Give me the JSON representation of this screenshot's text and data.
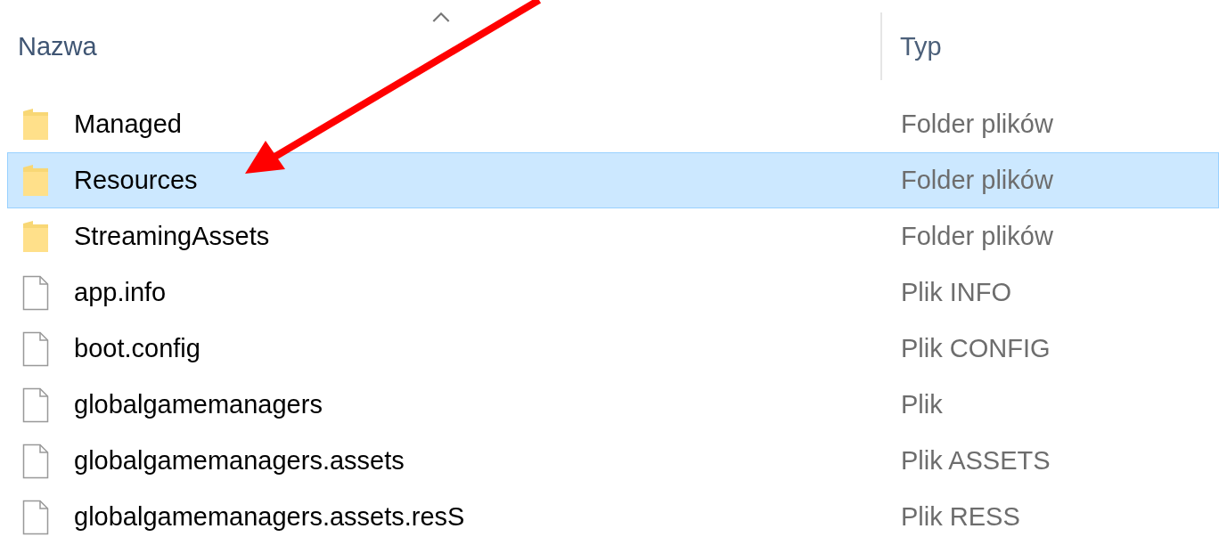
{
  "columns": [
    {
      "label": "Nazwa",
      "sorted": true
    },
    {
      "label": "Typ"
    }
  ],
  "rows": [
    {
      "name": "Managed",
      "type": "Folder plików",
      "kind": "folder",
      "selected": false
    },
    {
      "name": "Resources",
      "type": "Folder plików",
      "kind": "folder",
      "selected": true
    },
    {
      "name": "StreamingAssets",
      "type": "Folder plików",
      "kind": "folder",
      "selected": false
    },
    {
      "name": "app.info",
      "type": "Plik INFO",
      "kind": "file",
      "selected": false
    },
    {
      "name": "boot.config",
      "type": "Plik CONFIG",
      "kind": "file",
      "selected": false
    },
    {
      "name": "globalgamemanagers",
      "type": "Plik",
      "kind": "file",
      "selected": false
    },
    {
      "name": "globalgamemanagers.assets",
      "type": "Plik ASSETS",
      "kind": "file",
      "selected": false
    },
    {
      "name": "globalgamemanagers.assets.resS",
      "type": "Plik RESS",
      "kind": "file",
      "selected": false
    }
  ]
}
